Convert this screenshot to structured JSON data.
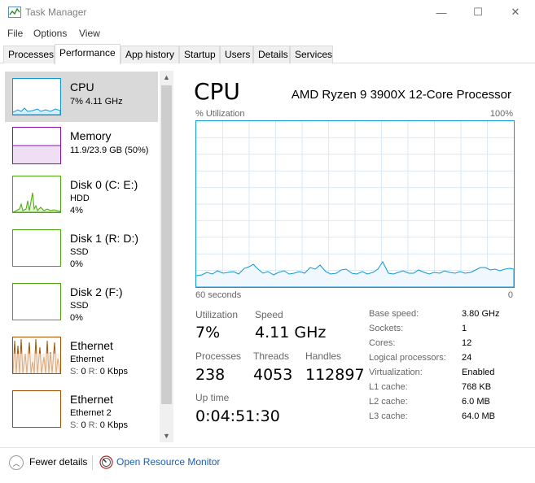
{
  "window": {
    "title": "Task Manager",
    "controls": {
      "minimize": "—",
      "maximize": "☐",
      "close": "✕"
    }
  },
  "menu": [
    "File",
    "Options",
    "View"
  ],
  "tabs": [
    "Processes",
    "Performance",
    "App history",
    "Startup",
    "Users",
    "Details",
    "Services"
  ],
  "active_tab": "Performance",
  "sidebar": {
    "items": [
      {
        "name": "CPU",
        "detail1": "7%  4.11 GHz",
        "selected": true,
        "color": "#1197d4"
      },
      {
        "name": "Memory",
        "detail1": "11.9/23.9 GB (50%)",
        "color": "#8b12ae"
      },
      {
        "name": "Disk 0 (C: E:)",
        "detail1": "HDD",
        "detail2": "4%",
        "color": "#4da60c"
      },
      {
        "name": "Disk 1 (R: D:)",
        "detail1": "SSD",
        "detail2": "0%",
        "color": "#4da60c"
      },
      {
        "name": "Disk 2 (F:)",
        "detail1": "SSD",
        "detail2": "0%",
        "color": "#4da60c"
      },
      {
        "name": "Ethernet",
        "detail1": "Ethernet",
        "detail2_s": "S:",
        "detail2_s_val": "0",
        "detail2_r": "R:",
        "detail2_r_val": "0 Kbps",
        "color": "#a74f01"
      },
      {
        "name": "Ethernet",
        "detail1": "Ethernet 2",
        "detail2_s": "S:",
        "detail2_s_val": "0",
        "detail2_r": "R:",
        "detail2_r_val": "0 Kbps",
        "color": "#a74f01"
      }
    ]
  },
  "main": {
    "heading": "CPU",
    "model": "AMD Ryzen 9 3900X 12-Core Processor",
    "util_label": "% Utilization",
    "util_max": "100%",
    "axis_left": "60 seconds",
    "axis_right": "0",
    "graph_color": "#1197d4",
    "stats": {
      "utilization_label": "Utilization",
      "utilization": "7%",
      "speed_label": "Speed",
      "speed": "4.11 GHz",
      "processes_label": "Processes",
      "processes": "238",
      "threads_label": "Threads",
      "threads": "4053",
      "handles_label": "Handles",
      "handles": "112897",
      "uptime_label": "Up time",
      "uptime": "0:04:51:30"
    },
    "specs": [
      {
        "label": "Base speed:",
        "value": "3.80 GHz"
      },
      {
        "label": "Sockets:",
        "value": "1"
      },
      {
        "label": "Cores:",
        "value": "12"
      },
      {
        "label": "Logical processors:",
        "value": "24"
      },
      {
        "label": "Virtualization:",
        "value": "Enabled"
      },
      {
        "label": "L1 cache:",
        "value": "768 KB"
      },
      {
        "label": "L2 cache:",
        "value": "6.0 MB"
      },
      {
        "label": "L3 cache:",
        "value": "64.0 MB"
      }
    ]
  },
  "footer": {
    "fewer_details": "Fewer details",
    "open_monitor": "Open Resource Monitor"
  }
}
